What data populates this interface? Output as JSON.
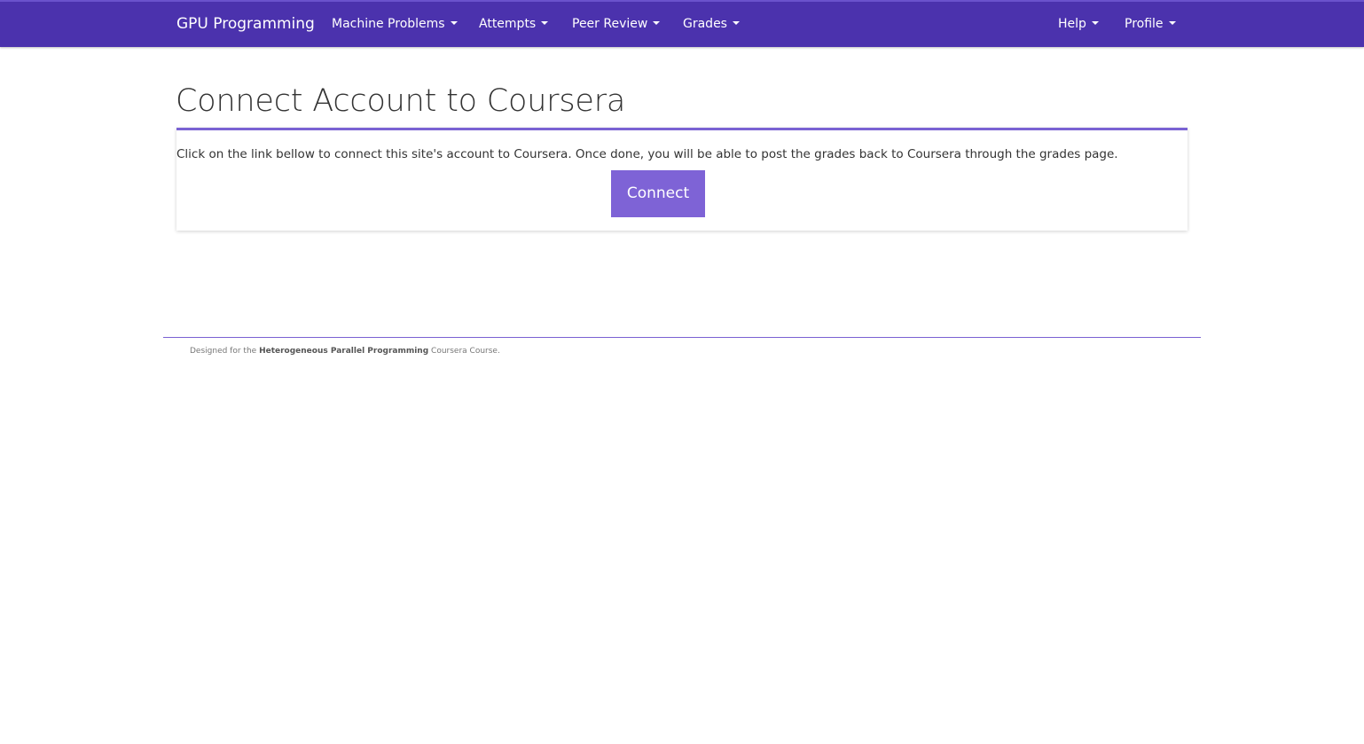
{
  "navbar": {
    "brand": "GPU Programming",
    "left_items": [
      {
        "label": "Machine Problems"
      },
      {
        "label": "Attempts"
      },
      {
        "label": "Peer Review"
      },
      {
        "label": "Grades"
      }
    ],
    "right_items": [
      {
        "label": "Help"
      },
      {
        "label": "Profile"
      }
    ],
    "background_color": "#4b32ad"
  },
  "main": {
    "title": "Connect Account to Coursera",
    "description": "Click on the link bellow to connect this site's account to Coursera. Once done, you will be able to post the grades back to Coursera through the grades page.",
    "connect_label": "Connect",
    "accent_color": "#7e63d6"
  },
  "footer": {
    "prefix": "Designed for the ",
    "course_name": "Heterogeneous Parallel Programming",
    "suffix": " Coursera Course."
  }
}
